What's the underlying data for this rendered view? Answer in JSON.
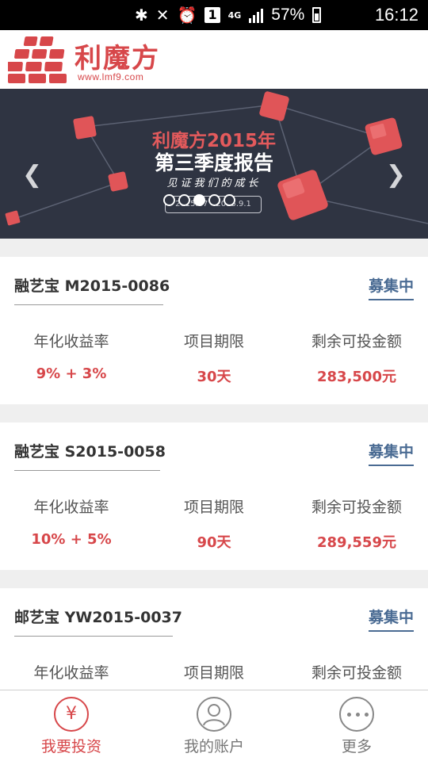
{
  "status_bar": {
    "battery": "57%",
    "time": "16:12",
    "notification_badge": "1",
    "network": "4G"
  },
  "header": {
    "logo_text": "利魔方",
    "logo_url": "www.lmf9.com",
    "brand_color": "#d7474a"
  },
  "banner": {
    "title": "利魔方2015年",
    "subtitle": "第三季度报告",
    "slogan": "见证我们的成长",
    "date_range": "2015.07 - 2015.9.1",
    "slide_count": 5,
    "active_slide": 2,
    "prev_icon": "chevron-left-icon",
    "next_icon": "chevron-right-icon"
  },
  "products": [
    {
      "name": "融艺宝 M2015-0086",
      "status": "募集中",
      "rate_label": "年化收益率",
      "rate_value": "9% + 3%",
      "term_label": "项目期限",
      "term_value": "30天",
      "remaining_label": "剩余可投金额",
      "remaining_value": "283,500元"
    },
    {
      "name": "融艺宝 S2015-0058",
      "status": "募集中",
      "rate_label": "年化收益率",
      "rate_value": "10% + 5%",
      "term_label": "项目期限",
      "term_value": "90天",
      "remaining_label": "剩余可投金额",
      "remaining_value": "289,559元"
    },
    {
      "name": "邮艺宝 YW2015-0037",
      "status": "募集中",
      "rate_label": "年化收益率",
      "rate_value": "",
      "term_label": "项目期限",
      "term_value": "",
      "remaining_label": "剩余可投金额",
      "remaining_value": ""
    }
  ],
  "bottom_nav": {
    "items": [
      {
        "label": "我要投资",
        "icon": "yen-icon",
        "active": true
      },
      {
        "label": "我的账户",
        "icon": "user-icon",
        "active": false
      },
      {
        "label": "更多",
        "icon": "more-icon",
        "active": false
      }
    ],
    "yen_symbol": "¥"
  }
}
